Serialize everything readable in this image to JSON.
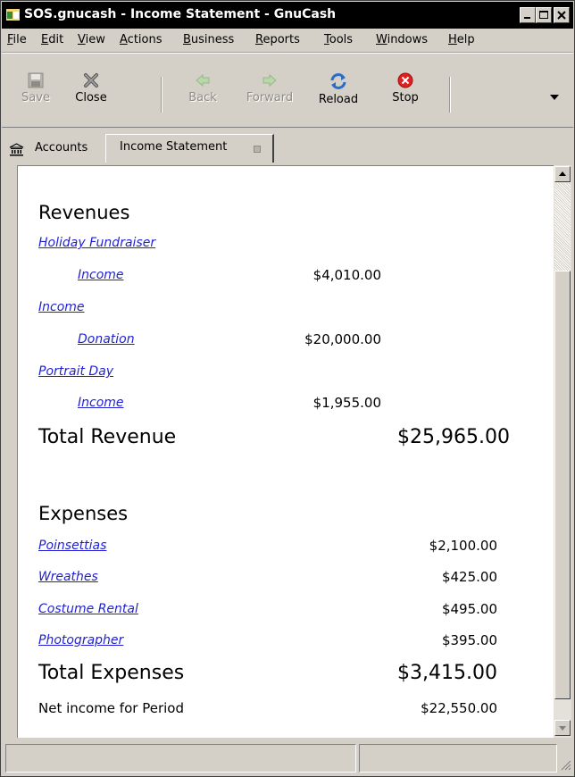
{
  "window": {
    "title": "SOS.gnucash - Income Statement - GnuCash"
  },
  "menu": [
    {
      "pre": "",
      "u": "F",
      "post": "ile"
    },
    {
      "pre": "",
      "u": "E",
      "post": "dit"
    },
    {
      "pre": "",
      "u": "V",
      "post": "iew"
    },
    {
      "pre": "",
      "u": "A",
      "post": "ctions"
    },
    {
      "pre": "",
      "u": "B",
      "post": "usiness"
    },
    {
      "pre": "",
      "u": "R",
      "post": "eports"
    },
    {
      "pre": "",
      "u": "T",
      "post": "ools"
    },
    {
      "pre": "",
      "u": "W",
      "post": "indows"
    },
    {
      "pre": "",
      "u": "H",
      "post": "elp"
    }
  ],
  "toolbar": {
    "save": "Save",
    "close": "Close",
    "back": "Back",
    "forward": "Forward",
    "reload": "Reload",
    "stop": "Stop"
  },
  "tabs": {
    "accounts": "Accounts",
    "income_statement": "Income Statement"
  },
  "report": {
    "revenues_heading": "Revenues",
    "revenues": [
      {
        "account": "Holiday Fundraiser",
        "sub": "Income",
        "amount": "$4,010.00"
      },
      {
        "account": "Income",
        "sub": "Donation",
        "amount": "$20,000.00"
      },
      {
        "account": "Portrait Day",
        "sub": "Income",
        "amount": "$1,955.00"
      }
    ],
    "total_revenue_label": "Total Revenue",
    "total_revenue": "$25,965.00",
    "expenses_heading": "Expenses",
    "expenses": [
      {
        "account": "Poinsettias",
        "amount": "$2,100.00"
      },
      {
        "account": "Wreathes",
        "amount": "$425.00"
      },
      {
        "account": "Costume Rental",
        "amount": "$495.00"
      },
      {
        "account": "Photographer",
        "amount": "$395.00"
      }
    ],
    "total_expenses_label": "Total Expenses",
    "total_expenses": "$3,415.00",
    "net_income_label": "Net income for Period",
    "net_income": "$22,550.00"
  },
  "colors": {
    "link": "#1f1fd6",
    "stop_red": "#e02020",
    "titlebar": "#000000"
  }
}
